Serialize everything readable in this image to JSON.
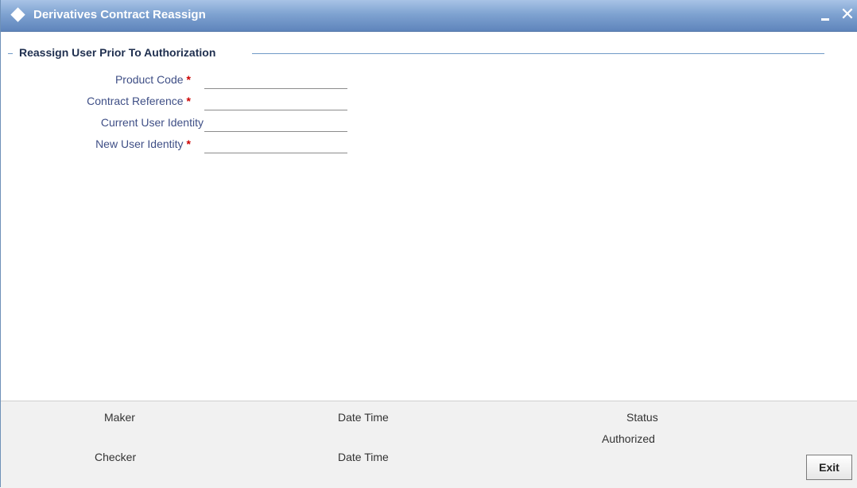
{
  "window": {
    "title": "Derivatives Contract Reassign",
    "minimize_glyph": "",
    "close_glyph": "✕"
  },
  "section": {
    "title": "Reassign User Prior To Authorization"
  },
  "form": {
    "fields": [
      {
        "label": "Product Code",
        "required": "*",
        "value": ""
      },
      {
        "label": "Contract Reference",
        "required": "*",
        "value": ""
      },
      {
        "label": "Current User Identity",
        "required": "",
        "value": ""
      },
      {
        "label": "New User Identity",
        "required": "*",
        "value": ""
      }
    ]
  },
  "footer": {
    "maker_label": "Maker",
    "checker_label": "Checker",
    "maker_datetime_label": "Date Time",
    "checker_datetime_label": "Date Time",
    "status_label": "Status",
    "status_value": "Authorized",
    "exit_label": "Exit"
  },
  "colors": {
    "titlebar": "#7fa3d1",
    "label_text": "#3f4f86",
    "required_marker": "#cc0000",
    "section_rule": "#6f9ac6"
  }
}
